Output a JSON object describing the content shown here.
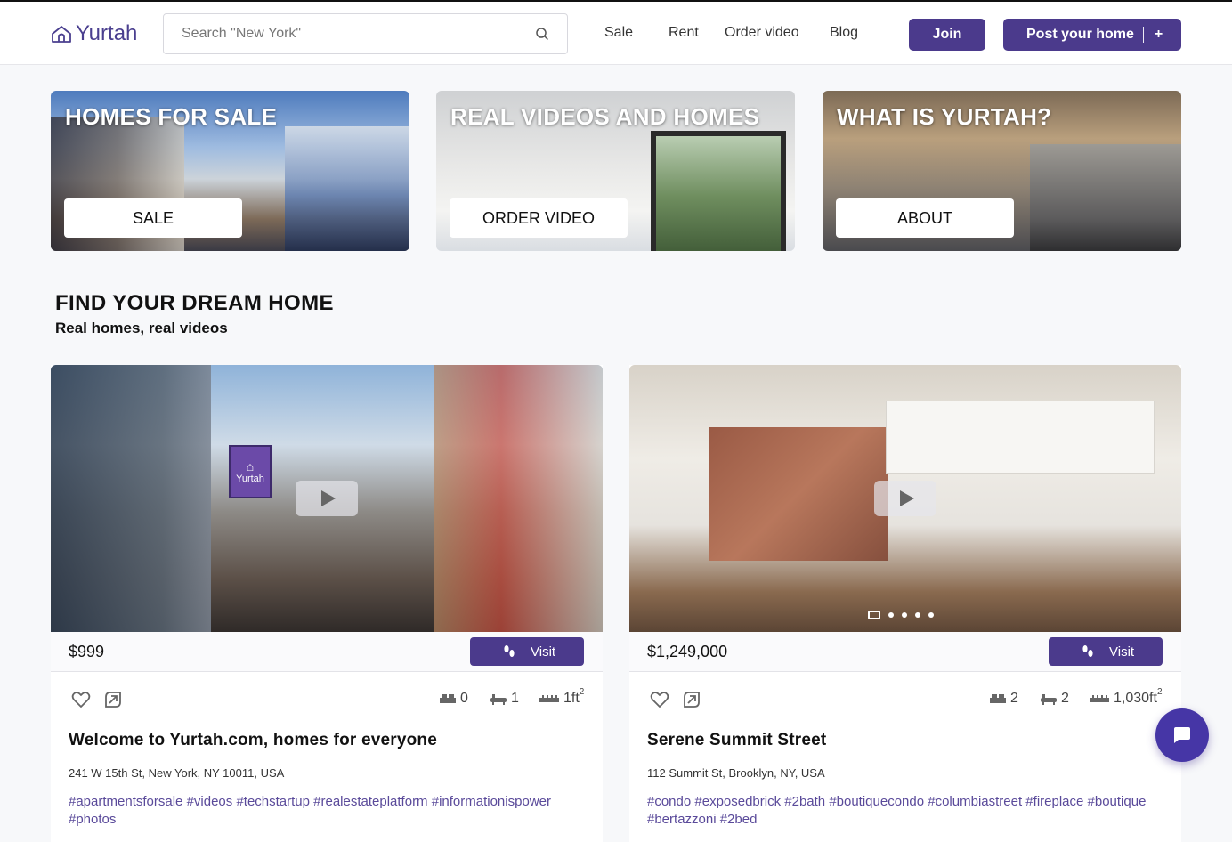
{
  "header": {
    "logo_text": "Yurtah",
    "search_placeholder": "Search \"New York\"",
    "nav": [
      "Sale",
      "Rent",
      "Order video",
      "Blog"
    ],
    "join_label": "Join",
    "post_label": "Post your home",
    "post_plus": "+"
  },
  "promos": [
    {
      "title": "HOMES FOR SALE",
      "button": "SALE"
    },
    {
      "title": "REAL VIDEOS AND HOMES",
      "button": "ORDER VIDEO"
    },
    {
      "title": "WHAT IS YURTAH?",
      "button": "ABOUT"
    }
  ],
  "section": {
    "title": "FIND YOUR DREAM HOME",
    "subtitle": "Real homes, real videos"
  },
  "listings": [
    {
      "price": "$999",
      "visit_label": "Visit",
      "beds": "0",
      "baths": "1",
      "area": "1ft",
      "area_sup": "2",
      "title": "Welcome to Yurtah.com, homes for everyone",
      "address": "241 W 15th St, New York, NY 10011, USA",
      "tags": "#apartmentsforsale #videos #techstartup #realestateplatform #informationispower #photos",
      "photo_brand": "Yurtah"
    },
    {
      "price": "$1,249,000",
      "visit_label": "Visit",
      "beds": "2",
      "baths": "2",
      "area": "1,030ft",
      "area_sup": "2",
      "title": "Serene Summit Street",
      "address": "112 Summit St, Brooklyn, NY, USA",
      "tags": "#condo #exposedbrick #2bath #boutiquecondo #columbiastreet #fireplace #boutique #bertazzoni #2bed"
    }
  ],
  "colors": {
    "brand": "#4b3a8c",
    "tag": "#5a4a9a",
    "chat": "#4636a6"
  }
}
